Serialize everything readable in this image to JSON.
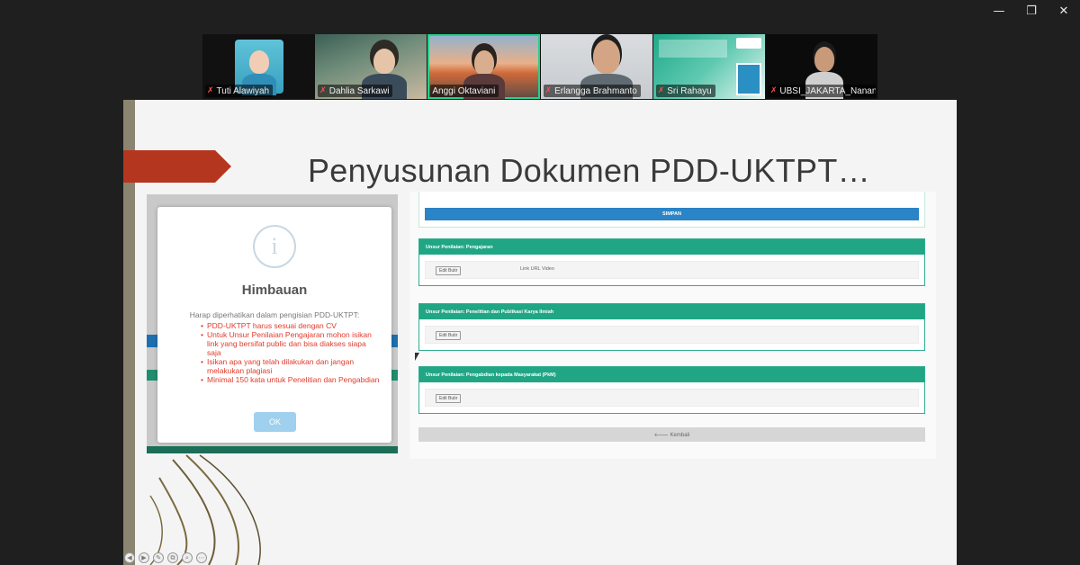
{
  "window": {
    "minimize": "—",
    "restore": "❐",
    "close": "✕"
  },
  "participants": [
    {
      "name": "Tuti Alawiyah",
      "muted": true
    },
    {
      "name": "Dahlia Sarkawi",
      "muted": true
    },
    {
      "name": "Anggi Oktaviani",
      "muted": false,
      "active": true
    },
    {
      "name": "Erlangga Brahmanto",
      "muted": true
    },
    {
      "name": "Sri Rahayu",
      "muted": true
    },
    {
      "name": "UBSI_JAKARTA_Nanan...",
      "muted": true
    }
  ],
  "slide": {
    "title": "Penyusunan Dokumen PDD-UKTPT…",
    "modal": {
      "icon": "i",
      "title": "Himbauan",
      "intro": "Harap diperhatikan dalam pengisian PDD-UKTPT:",
      "items": [
        "PDD-UKTPT harus sesuai dengan CV",
        "Untuk Unsur Penilaian Pengajaran mohon isikan link yang bersifat public dan bisa diakses siapa saja",
        "Isikan apa yang telah dilakukan dan jangan melakukan plagiasi",
        "Minimal 150 kata untuk Penelitian dan Pengabdian"
      ],
      "ok_label": "OK"
    },
    "form": {
      "save_label": "SIMPAN",
      "sections": [
        {
          "title": "Unsur Penilaian: Pengajaran",
          "button": "Edit Butir",
          "extra": "Link URL Video"
        },
        {
          "title": "Unsur Penilaian: Penelitian dan Publikasi Karya Ilmiah",
          "button": "Edit Butir",
          "extra": ""
        },
        {
          "title": "Unsur Penilaian: Pengabdian kepada Masyarakat (PkM)",
          "button": "Edit Butir",
          "extra": ""
        }
      ],
      "back_label": "🡐 Kembali"
    }
  },
  "nav_controls": [
    "◀",
    "▶",
    "✎",
    "⧉",
    "⌕",
    "⋯"
  ],
  "colors": {
    "accent_green": "#21a685",
    "save_blue": "#2a84c6",
    "alert_red": "#e23a2a",
    "title_arrow": "#b5361f"
  }
}
